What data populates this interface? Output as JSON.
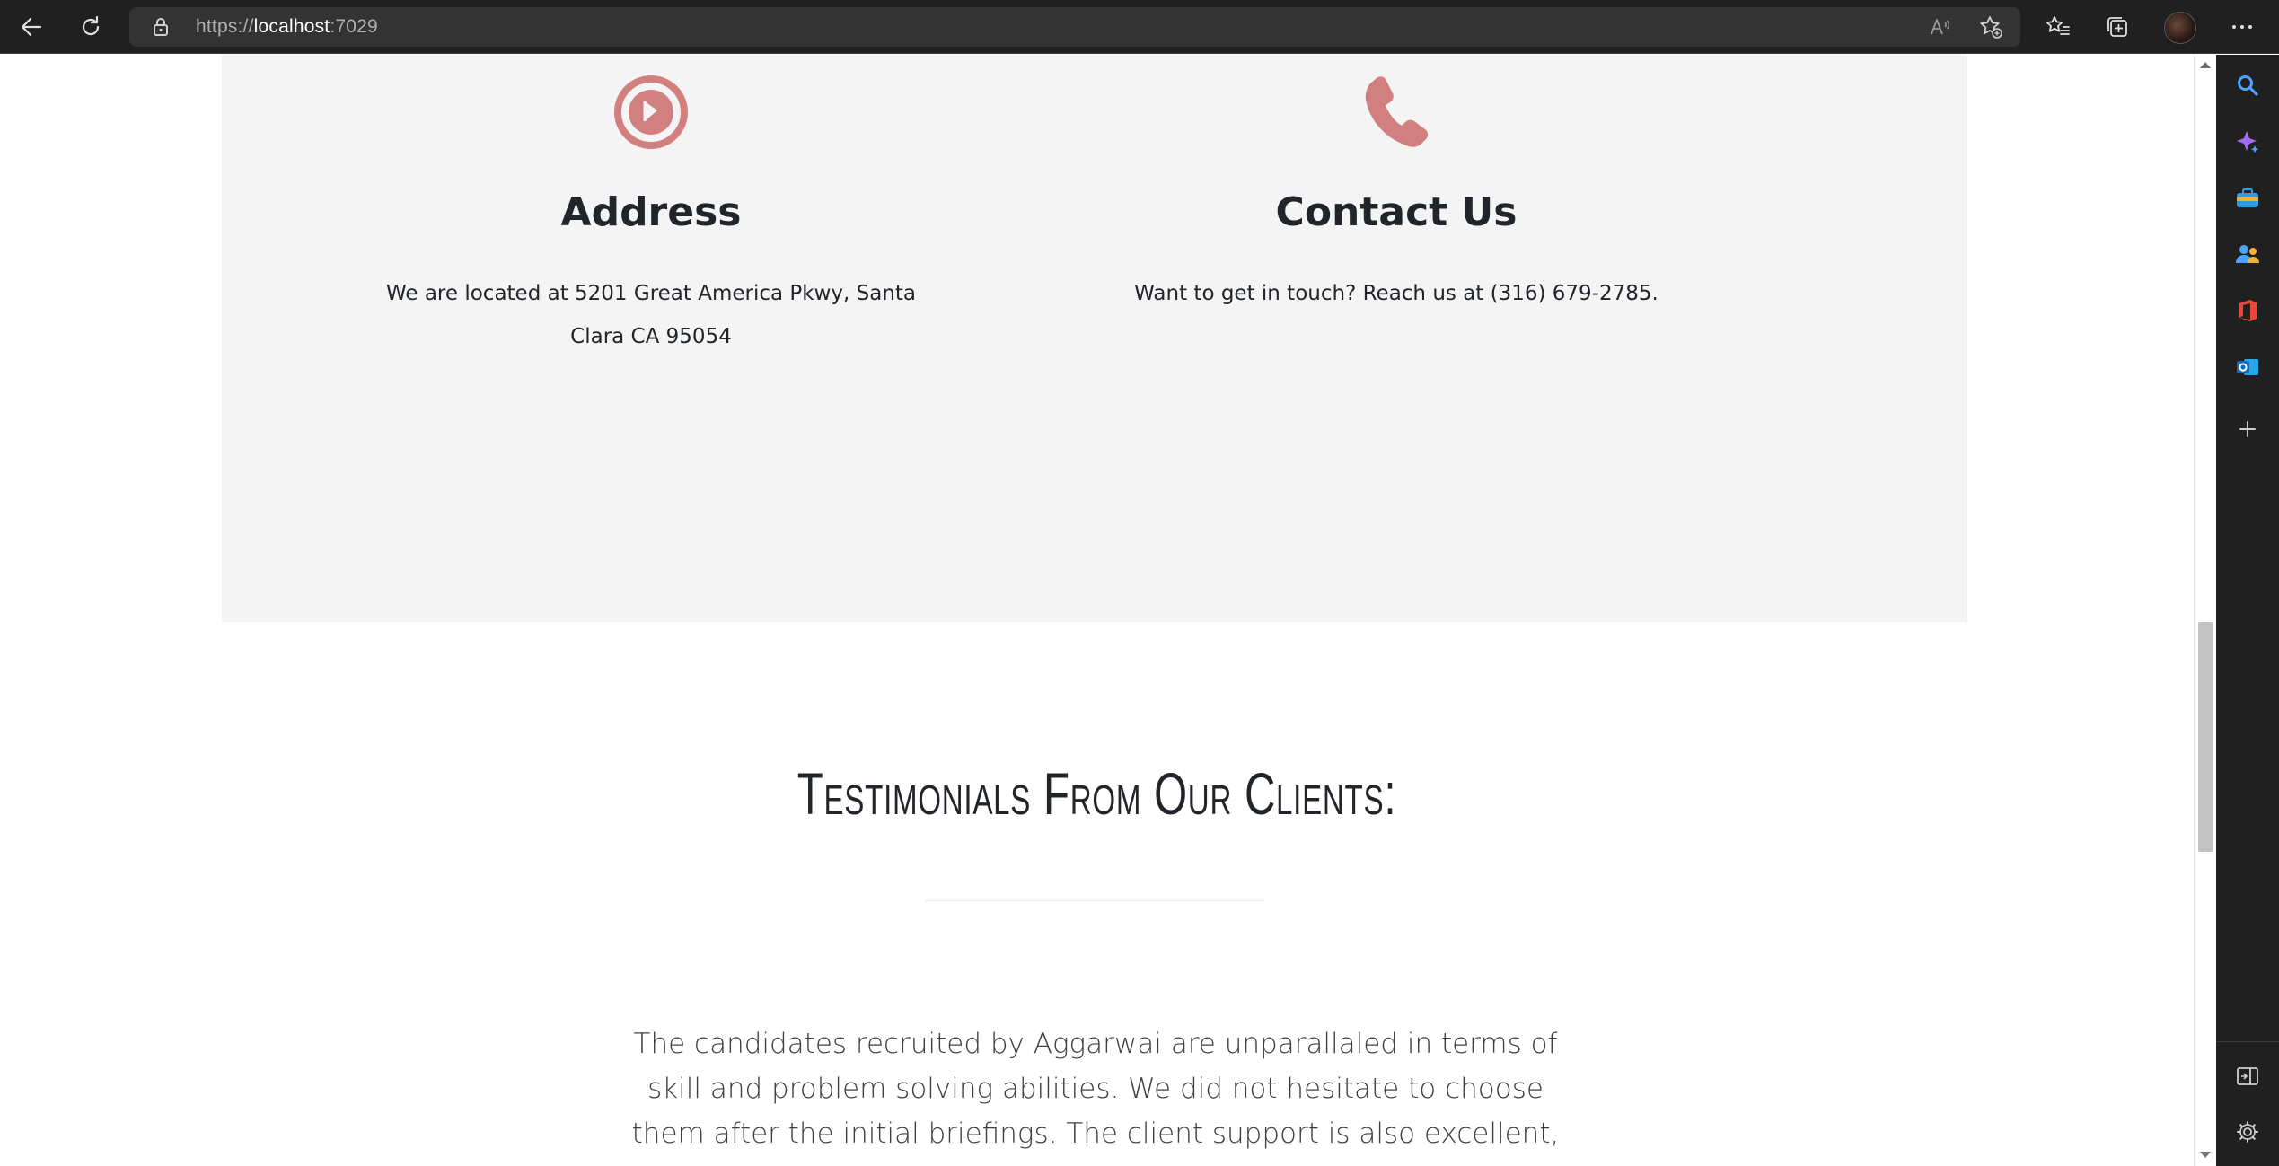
{
  "browser": {
    "url_scheme": "https://",
    "url_host": "localhost",
    "url_port": ":7029",
    "toolbar_icons": [
      "back-icon",
      "refresh-icon",
      "lock-icon",
      "read-aloud-icon",
      "add-favorite-icon",
      "favorites-icon",
      "collections-icon",
      "profile-avatar",
      "more-icon"
    ],
    "sidebar_icons": [
      "search-icon",
      "copilot-icon",
      "tools-icon",
      "people-icon",
      "office-icon",
      "outlook-icon",
      "add-icon",
      "split-screen-icon",
      "settings-icon"
    ]
  },
  "info": {
    "address": {
      "icon": "map-pin-icon",
      "title": "Address",
      "text": "We are located at 5201 Great America Pkwy, Santa Clara CA 95054"
    },
    "contact": {
      "icon": "phone-icon",
      "title": "Contact Us",
      "text": "Want to get in touch? Reach us at (316) 679-2785."
    },
    "accent_color": "#d17f7f"
  },
  "testimonials": {
    "heading": "Testimonials From Our Clients:",
    "quote": "The candidates recruited by Aggarwai are unparallaled in terms of skill and problem solving abilities. We did not hesitate to choose them after the initial briefings. The client support is also excellent, very approachable"
  }
}
